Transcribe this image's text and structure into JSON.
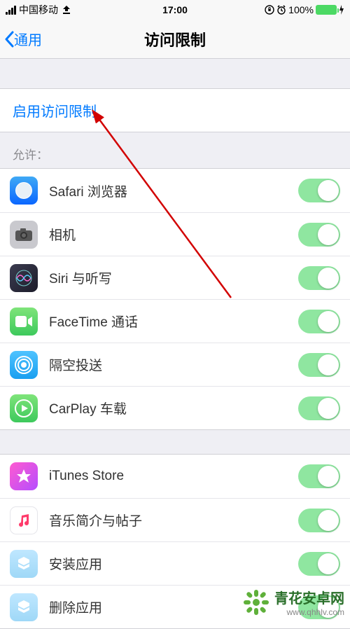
{
  "statusBar": {
    "carrier": "中国移动",
    "time": "17:00",
    "battery": "100%"
  },
  "nav": {
    "back": "通用",
    "title": "访问限制"
  },
  "enable": {
    "label": "启用访问限制"
  },
  "allowHeader": "允许：",
  "group1": [
    {
      "name": "safari",
      "label": "Safari 浏览器",
      "iconClass": "ic-safari"
    },
    {
      "name": "camera",
      "label": "相机",
      "iconClass": "ic-camera"
    },
    {
      "name": "siri",
      "label": "Siri 与听写",
      "iconClass": "ic-siri"
    },
    {
      "name": "facetime",
      "label": "FaceTime 通话",
      "iconClass": "ic-facetime"
    },
    {
      "name": "airdrop",
      "label": "隔空投送",
      "iconClass": "ic-airdrop"
    },
    {
      "name": "carplay",
      "label": "CarPlay 车载",
      "iconClass": "ic-carplay"
    }
  ],
  "group2": [
    {
      "name": "itunes-store",
      "label": "iTunes Store",
      "iconClass": "ic-itunes"
    },
    {
      "name": "music-profile",
      "label": "音乐简介与帖子",
      "iconClass": "ic-music"
    },
    {
      "name": "install-apps",
      "label": "安装应用",
      "iconClass": "ic-install"
    },
    {
      "name": "delete-apps",
      "label": "删除应用",
      "iconClass": "ic-delete"
    }
  ],
  "watermark": {
    "cn": "青花安卓网",
    "url": "www.qhhlv.com"
  }
}
